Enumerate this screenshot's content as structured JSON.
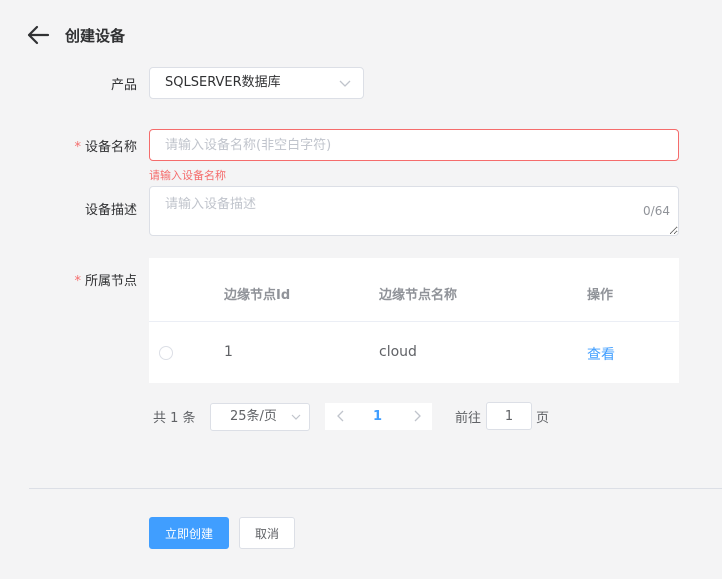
{
  "header": {
    "title": "创建设备",
    "back_icon": "arrow-left-icon"
  },
  "form": {
    "product": {
      "label": "产品",
      "value": "SQLSERVER数据库",
      "icon": "chevron-down-icon"
    },
    "device_name": {
      "required_mark": "*",
      "label": "设备名称",
      "value": "",
      "placeholder": "请输入设备名称(非空白字符)",
      "error": "请输入设备名称"
    },
    "device_desc": {
      "label": "设备描述",
      "value": "",
      "placeholder": "请输入设备描述",
      "counter": "0/64"
    },
    "node": {
      "required_mark": "*",
      "label": "所属节点"
    }
  },
  "table": {
    "columns": [
      "边缘节点Id",
      "边缘节点名称",
      "操作"
    ],
    "rows": [
      {
        "id": "1",
        "name": "cloud",
        "action": "查看"
      }
    ]
  },
  "pagination": {
    "total": "共 1 条",
    "page_size": "25条/页",
    "current_page": "1",
    "goto_label": "前往",
    "goto_value": "1",
    "goto_suffix": "页"
  },
  "footer": {
    "create_label": "立即创建",
    "cancel_label": "取消"
  },
  "colors": {
    "primary": "#409eff",
    "danger": "#f56c6c",
    "background": "#f4f4f5"
  }
}
